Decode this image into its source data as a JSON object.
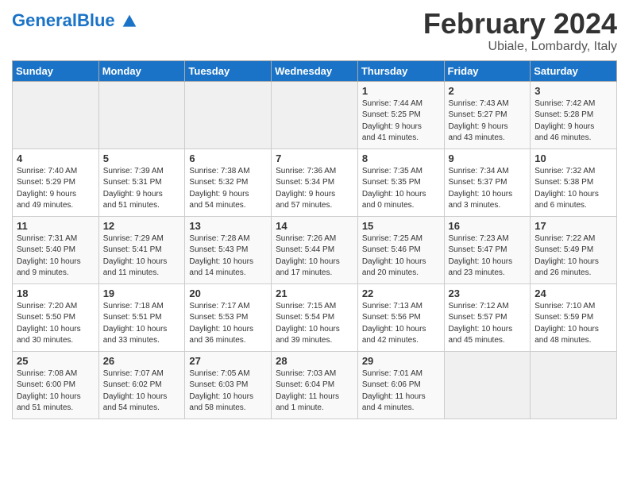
{
  "header": {
    "logo_general": "General",
    "logo_blue": "Blue",
    "title": "February 2024",
    "subtitle": "Ubiale, Lombardy, Italy"
  },
  "weekdays": [
    "Sunday",
    "Monday",
    "Tuesday",
    "Wednesday",
    "Thursday",
    "Friday",
    "Saturday"
  ],
  "weeks": [
    [
      {
        "day": "",
        "info": ""
      },
      {
        "day": "",
        "info": ""
      },
      {
        "day": "",
        "info": ""
      },
      {
        "day": "",
        "info": ""
      },
      {
        "day": "1",
        "info": "Sunrise: 7:44 AM\nSunset: 5:25 PM\nDaylight: 9 hours\nand 41 minutes."
      },
      {
        "day": "2",
        "info": "Sunrise: 7:43 AM\nSunset: 5:27 PM\nDaylight: 9 hours\nand 43 minutes."
      },
      {
        "day": "3",
        "info": "Sunrise: 7:42 AM\nSunset: 5:28 PM\nDaylight: 9 hours\nand 46 minutes."
      }
    ],
    [
      {
        "day": "4",
        "info": "Sunrise: 7:40 AM\nSunset: 5:29 PM\nDaylight: 9 hours\nand 49 minutes."
      },
      {
        "day": "5",
        "info": "Sunrise: 7:39 AM\nSunset: 5:31 PM\nDaylight: 9 hours\nand 51 minutes."
      },
      {
        "day": "6",
        "info": "Sunrise: 7:38 AM\nSunset: 5:32 PM\nDaylight: 9 hours\nand 54 minutes."
      },
      {
        "day": "7",
        "info": "Sunrise: 7:36 AM\nSunset: 5:34 PM\nDaylight: 9 hours\nand 57 minutes."
      },
      {
        "day": "8",
        "info": "Sunrise: 7:35 AM\nSunset: 5:35 PM\nDaylight: 10 hours\nand 0 minutes."
      },
      {
        "day": "9",
        "info": "Sunrise: 7:34 AM\nSunset: 5:37 PM\nDaylight: 10 hours\nand 3 minutes."
      },
      {
        "day": "10",
        "info": "Sunrise: 7:32 AM\nSunset: 5:38 PM\nDaylight: 10 hours\nand 6 minutes."
      }
    ],
    [
      {
        "day": "11",
        "info": "Sunrise: 7:31 AM\nSunset: 5:40 PM\nDaylight: 10 hours\nand 9 minutes."
      },
      {
        "day": "12",
        "info": "Sunrise: 7:29 AM\nSunset: 5:41 PM\nDaylight: 10 hours\nand 11 minutes."
      },
      {
        "day": "13",
        "info": "Sunrise: 7:28 AM\nSunset: 5:43 PM\nDaylight: 10 hours\nand 14 minutes."
      },
      {
        "day": "14",
        "info": "Sunrise: 7:26 AM\nSunset: 5:44 PM\nDaylight: 10 hours\nand 17 minutes."
      },
      {
        "day": "15",
        "info": "Sunrise: 7:25 AM\nSunset: 5:46 PM\nDaylight: 10 hours\nand 20 minutes."
      },
      {
        "day": "16",
        "info": "Sunrise: 7:23 AM\nSunset: 5:47 PM\nDaylight: 10 hours\nand 23 minutes."
      },
      {
        "day": "17",
        "info": "Sunrise: 7:22 AM\nSunset: 5:49 PM\nDaylight: 10 hours\nand 26 minutes."
      }
    ],
    [
      {
        "day": "18",
        "info": "Sunrise: 7:20 AM\nSunset: 5:50 PM\nDaylight: 10 hours\nand 30 minutes."
      },
      {
        "day": "19",
        "info": "Sunrise: 7:18 AM\nSunset: 5:51 PM\nDaylight: 10 hours\nand 33 minutes."
      },
      {
        "day": "20",
        "info": "Sunrise: 7:17 AM\nSunset: 5:53 PM\nDaylight: 10 hours\nand 36 minutes."
      },
      {
        "day": "21",
        "info": "Sunrise: 7:15 AM\nSunset: 5:54 PM\nDaylight: 10 hours\nand 39 minutes."
      },
      {
        "day": "22",
        "info": "Sunrise: 7:13 AM\nSunset: 5:56 PM\nDaylight: 10 hours\nand 42 minutes."
      },
      {
        "day": "23",
        "info": "Sunrise: 7:12 AM\nSunset: 5:57 PM\nDaylight: 10 hours\nand 45 minutes."
      },
      {
        "day": "24",
        "info": "Sunrise: 7:10 AM\nSunset: 5:59 PM\nDaylight: 10 hours\nand 48 minutes."
      }
    ],
    [
      {
        "day": "25",
        "info": "Sunrise: 7:08 AM\nSunset: 6:00 PM\nDaylight: 10 hours\nand 51 minutes."
      },
      {
        "day": "26",
        "info": "Sunrise: 7:07 AM\nSunset: 6:02 PM\nDaylight: 10 hours\nand 54 minutes."
      },
      {
        "day": "27",
        "info": "Sunrise: 7:05 AM\nSunset: 6:03 PM\nDaylight: 10 hours\nand 58 minutes."
      },
      {
        "day": "28",
        "info": "Sunrise: 7:03 AM\nSunset: 6:04 PM\nDaylight: 11 hours\nand 1 minute."
      },
      {
        "day": "29",
        "info": "Sunrise: 7:01 AM\nSunset: 6:06 PM\nDaylight: 11 hours\nand 4 minutes."
      },
      {
        "day": "",
        "info": ""
      },
      {
        "day": "",
        "info": ""
      }
    ]
  ]
}
